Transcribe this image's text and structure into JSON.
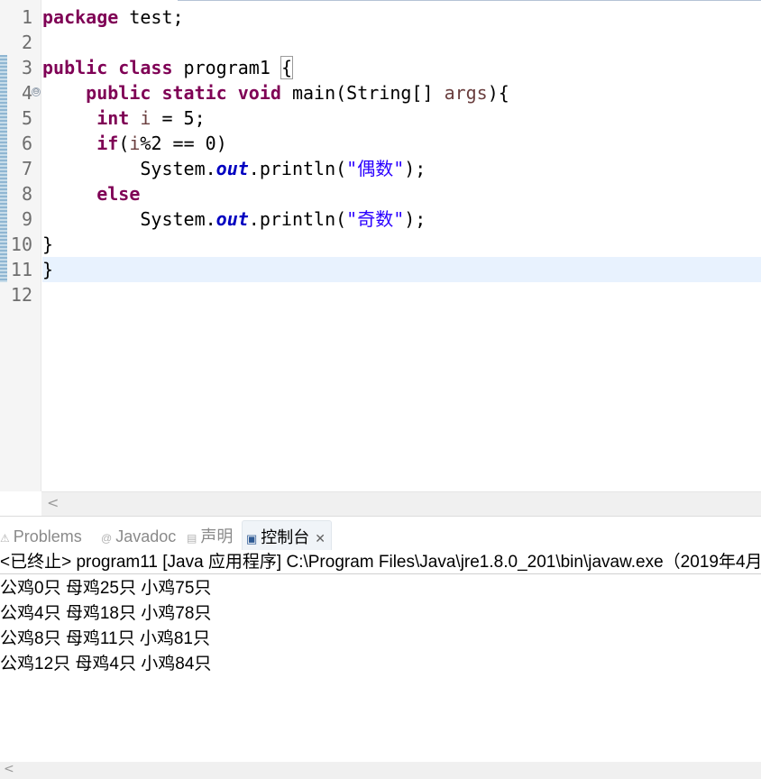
{
  "editor": {
    "line_numbers": [
      "1",
      "2",
      "3",
      "4",
      "5",
      "6",
      "7",
      "8",
      "9",
      "10",
      "11",
      "12"
    ],
    "fold_icon_glyph": "⊖",
    "code": {
      "l1_kw": "package",
      "l1_rest": " test;",
      "l3_kw1": "public",
      "l3_kw2": "class",
      "l3_name": " program1 ",
      "l3_brace": "{",
      "l4_kw1": "public",
      "l4_kw2": "static",
      "l4_kw3": "void",
      "l4_sig": " main(String[] ",
      "l4_arg": "args",
      "l4_end": "){",
      "l5_kw": "int",
      "l5_var": " i",
      "l5_rest": " = 5;",
      "l6_kw": "if",
      "l6_open": "(",
      "l6_var": "i",
      "l6_rest": "%2 == 0)",
      "l7_obj": "System.",
      "l7_field": "out",
      "l7_call": ".println(",
      "l7_str": "\"偶数\"",
      "l7_end": ");",
      "l8_kw": "else",
      "l9_obj": "System.",
      "l9_field": "out",
      "l9_call": ".println(",
      "l9_str": "\"奇数\"",
      "l9_end": ");",
      "l10": "}",
      "l11": "}"
    },
    "scroll_left_glyph": "<"
  },
  "views": {
    "tabs": [
      {
        "label": "Problems",
        "icon": "problems-icon",
        "glyph": "⚠"
      },
      {
        "label": "Javadoc",
        "icon": "javadoc-icon",
        "glyph": "@"
      },
      {
        "label": "声明",
        "icon": "declaration-icon",
        "glyph": "▤"
      },
      {
        "label": "控制台",
        "icon": "console-icon",
        "glyph": "▣",
        "close_glyph": "✕"
      }
    ],
    "console": {
      "header": "<已终止> program11 [Java 应用程序] C:\\Program Files\\Java\\jre1.8.0_201\\bin\\javaw.exe（2019年4月",
      "output": [
        "公鸡0只 母鸡25只 小鸡75只",
        "公鸡4只 母鸡18只 小鸡78只",
        "公鸡8只 母鸡11只 小鸡81只",
        "公鸡12只 母鸡4只 小鸡84只"
      ],
      "scroll_left_glyph": "<"
    }
  },
  "colors": {
    "keyword": "#7f0055",
    "string": "#2a00ff",
    "field": "#0000c0",
    "local_var": "#6a3e3e",
    "current_line": "#e8f2fe"
  }
}
